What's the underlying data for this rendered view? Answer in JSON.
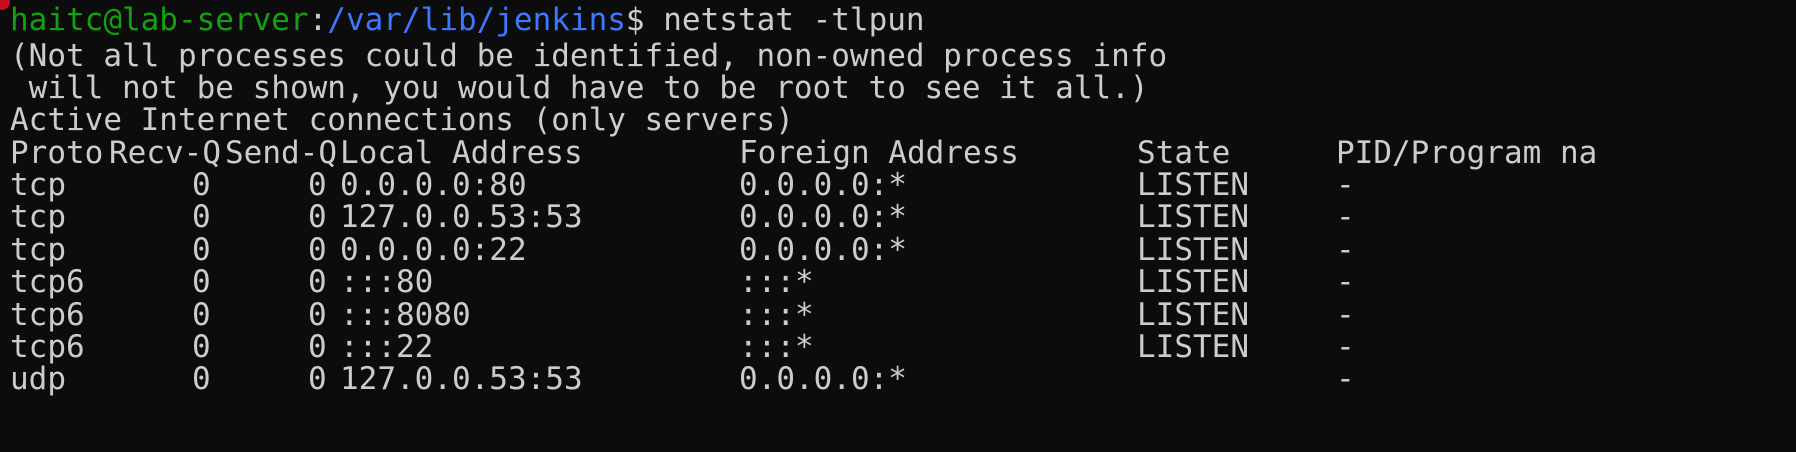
{
  "prompt": {
    "user_host": "haitc@lab-server",
    "separator": ":",
    "path": "/var/lib/jenkins",
    "symbol": "$",
    "command": "netstat -tlpun"
  },
  "messages": [
    "(Not all processes could be identified, non-owned process info",
    " will not be shown, you would have to be root to see it all.)",
    "Active Internet connections (only servers)"
  ],
  "table": {
    "headers": [
      "Proto",
      "Recv-Q",
      "Send-Q",
      "Local Address",
      "Foreign Address",
      "State",
      "PID/Program na"
    ],
    "rows": [
      [
        "tcp",
        "0",
        "0",
        "0.0.0.0:80",
        "0.0.0.0:*",
        "LISTEN",
        "-"
      ],
      [
        "tcp",
        "0",
        "0",
        "127.0.0.53:53",
        "0.0.0.0:*",
        "LISTEN",
        "-"
      ],
      [
        "tcp",
        "0",
        "0",
        "0.0.0.0:22",
        "0.0.0.0:*",
        "LISTEN",
        "-"
      ],
      [
        "tcp6",
        "0",
        "0",
        ":::80",
        ":::*",
        "LISTEN",
        "-"
      ],
      [
        "tcp6",
        "0",
        "0",
        ":::8080",
        ":::*",
        "LISTEN",
        "-"
      ],
      [
        "tcp6",
        "0",
        "0",
        ":::22",
        ":::*",
        "LISTEN",
        "-"
      ],
      [
        "udp",
        "0",
        "0",
        "127.0.0.53:53",
        "0.0.0.0:*",
        "",
        "-"
      ]
    ]
  },
  "colors": {
    "background": "#0c0c0c",
    "text": "#cccccc",
    "user_host": "#13a10e",
    "path": "#3b78ff"
  }
}
